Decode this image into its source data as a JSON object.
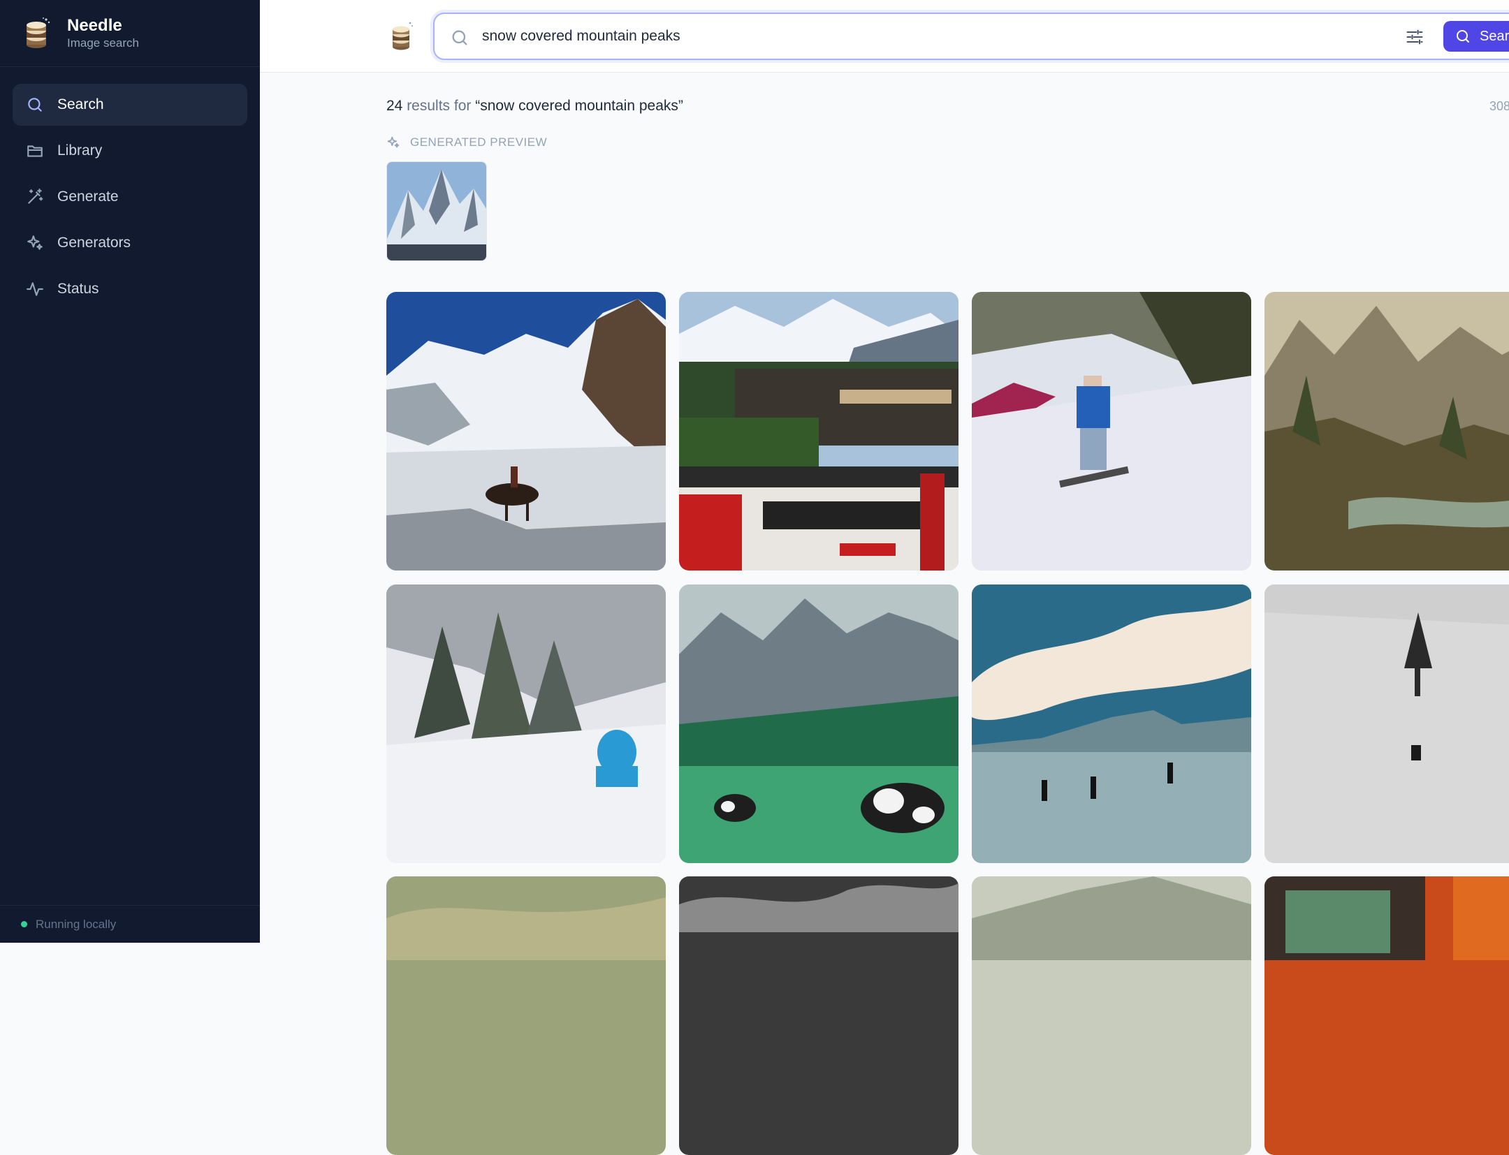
{
  "brand": {
    "name": "Needle",
    "subtitle": "Image search"
  },
  "sidebar": {
    "items": [
      {
        "label": "Search",
        "icon": "search-icon",
        "active": true
      },
      {
        "label": "Library",
        "icon": "folder-icon",
        "active": false
      },
      {
        "label": "Generate",
        "icon": "magic-wand-icon",
        "active": false
      },
      {
        "label": "Generators",
        "icon": "sparkles-icon",
        "active": false
      },
      {
        "label": "Status",
        "icon": "activity-icon",
        "active": false
      }
    ],
    "footer": "Running locally"
  },
  "search": {
    "value": "snow covered mountain peaks",
    "button_label": "Search"
  },
  "results": {
    "count": "24",
    "middle": " results for ",
    "query": "“snow covered mountain peaks”",
    "time": "308"
  },
  "generated_preview": {
    "label": "GENERATED PREVIEW"
  },
  "colors": {
    "sidebar_bg": "#111a2e",
    "accent": "#4f46e5",
    "status_dot": "#34d399"
  }
}
